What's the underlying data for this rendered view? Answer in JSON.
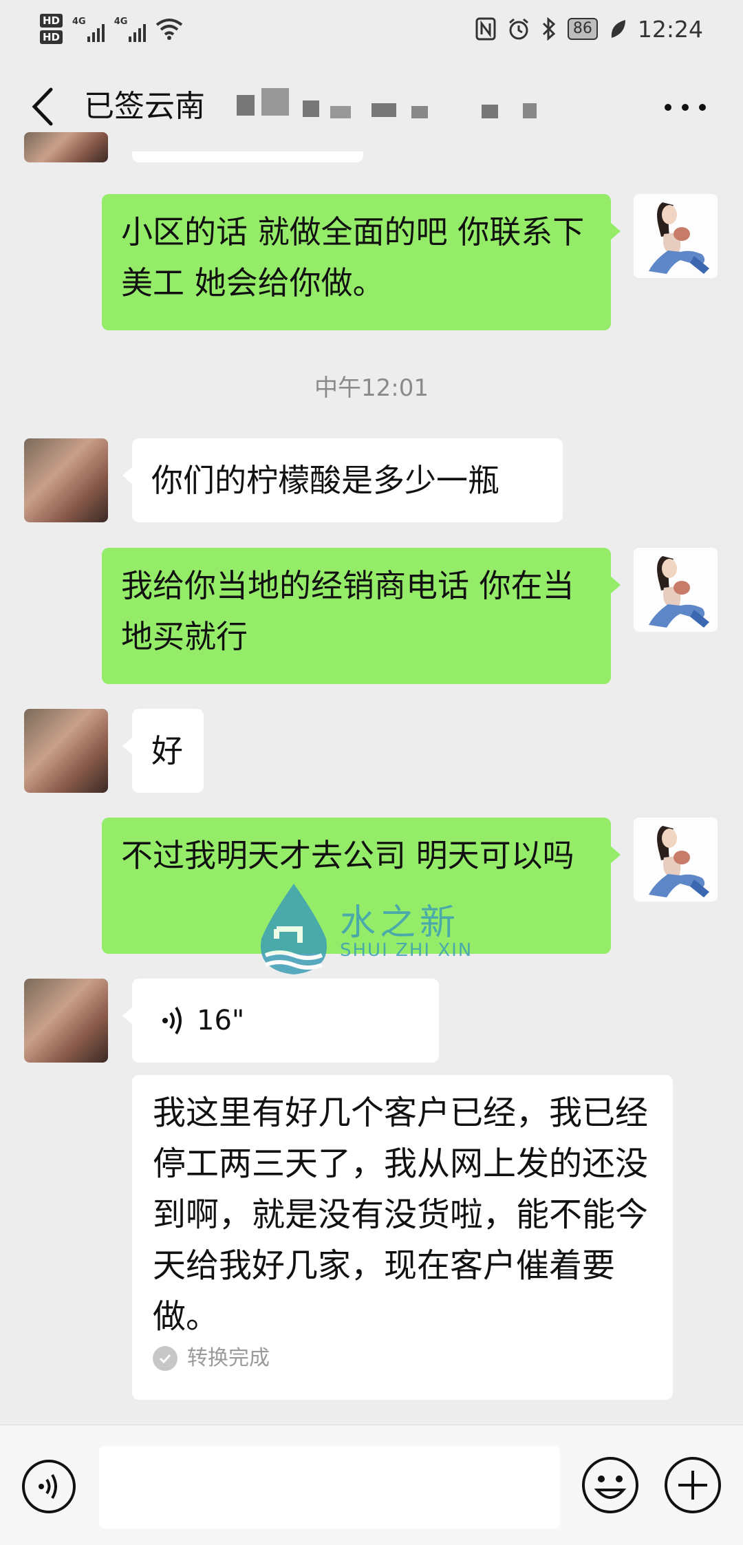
{
  "status_bar": {
    "hd1": "HD",
    "hd2": "HD",
    "sim1_network": "4G",
    "sim2_network": "4G",
    "battery_level": "86",
    "time": "12:24"
  },
  "header": {
    "title": "已签云南",
    "back_icon": "chevron-left-icon",
    "more_icon": "more-dots-icon"
  },
  "messages": [
    {
      "sender": "me",
      "text": "小区的话 就做全面的吧  你联系下美工  她会给你做。"
    },
    {
      "type": "timestamp",
      "text": "中午12:01"
    },
    {
      "sender": "them",
      "text": "你们的柠檬酸是多少一瓶"
    },
    {
      "sender": "me",
      "text": "我给你当地的经销商电话 你在当地买就行"
    },
    {
      "sender": "them",
      "text": "好"
    },
    {
      "sender": "me",
      "text": "不过我明天才去公司 明天可以吗"
    },
    {
      "sender": "them",
      "type": "voice",
      "duration": "16\""
    },
    {
      "sender": "them",
      "type": "transcript",
      "text": "我这里有好几个客户已经，我已经停工两三天了，我从网上发的还没到啊，就是没有没货啦，能不能今天给我好几家，现在客户催着要做。",
      "status": "转换完成"
    }
  ],
  "watermark": {
    "cn": "水之新",
    "en": "SHUI ZHI XIN",
    "color": "#3e9fb6"
  },
  "input_bar": {
    "voice_icon": "voice-toggle-icon",
    "emoji_icon": "emoji-icon",
    "plus_icon": "plus-icon"
  },
  "colors": {
    "bubble_me": "#95ec69",
    "bubble_them": "#ffffff",
    "background": "#ededed"
  }
}
